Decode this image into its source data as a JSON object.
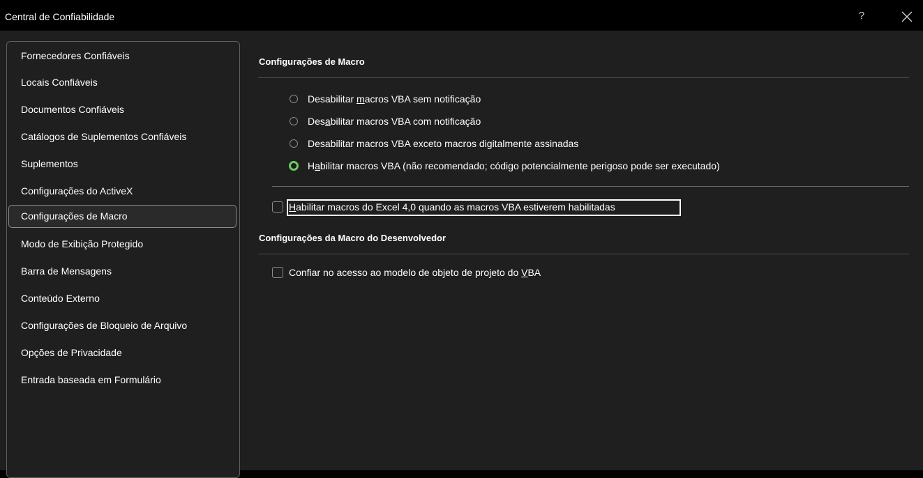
{
  "window": {
    "title": "Central de Confiabilidade",
    "help_label": "?",
    "close_icon": "close-icon"
  },
  "sidebar": {
    "items": [
      {
        "label": "Fornecedores Confiáveis"
      },
      {
        "label": "Locais Confiáveis"
      },
      {
        "label": "Documentos Confiáveis"
      },
      {
        "label": "Catálogos de Suplementos Confiáveis"
      },
      {
        "label": "Suplementos"
      },
      {
        "label": "Configurações do ActiveX"
      },
      {
        "label": "Configurações de Macro",
        "selected": true
      },
      {
        "label": "Modo de Exibição Protegido"
      },
      {
        "label": "Barra de Mensagens"
      },
      {
        "label": "Conteúdo Externo"
      },
      {
        "label": "Configurações de Bloqueio de Arquivo"
      },
      {
        "label": "Opções de Privacidade"
      },
      {
        "label": "Entrada baseada em Formulário"
      }
    ]
  },
  "macro_settings": {
    "header": "Configurações de Macro",
    "options": [
      {
        "pre": "Desabilitar ",
        "accel": "m",
        "post": "acros VBA sem notificação",
        "checked": false
      },
      {
        "pre": "Des",
        "accel": "a",
        "post": "bilitar macros VBA com notificação",
        "checked": false
      },
      {
        "pre": "Desabilitar macros VBA exceto macros di",
        "accel": "g",
        "post": "italmente assinadas",
        "checked": false
      },
      {
        "pre": "H",
        "accel": "a",
        "post": "bilitar macros VBA (não recomendado; código potencialmente perigoso pode ser executado)",
        "checked": true
      }
    ],
    "excel4": {
      "accel": "H",
      "post": "abilitar macros do Excel 4,0 quando as macros VBA estiverem habilitadas",
      "checked": false
    }
  },
  "developer_settings": {
    "header": "Configurações da Macro do Desenvolvedor",
    "vba_access": {
      "pre": "Confiar no acesso ao modelo de objeto de projeto do ",
      "accel": "V",
      "post": "BA",
      "checked": false
    }
  },
  "colors": {
    "accent_green": "#6ccb5f",
    "background": "#1f1f1f",
    "titlebar": "#000000"
  }
}
